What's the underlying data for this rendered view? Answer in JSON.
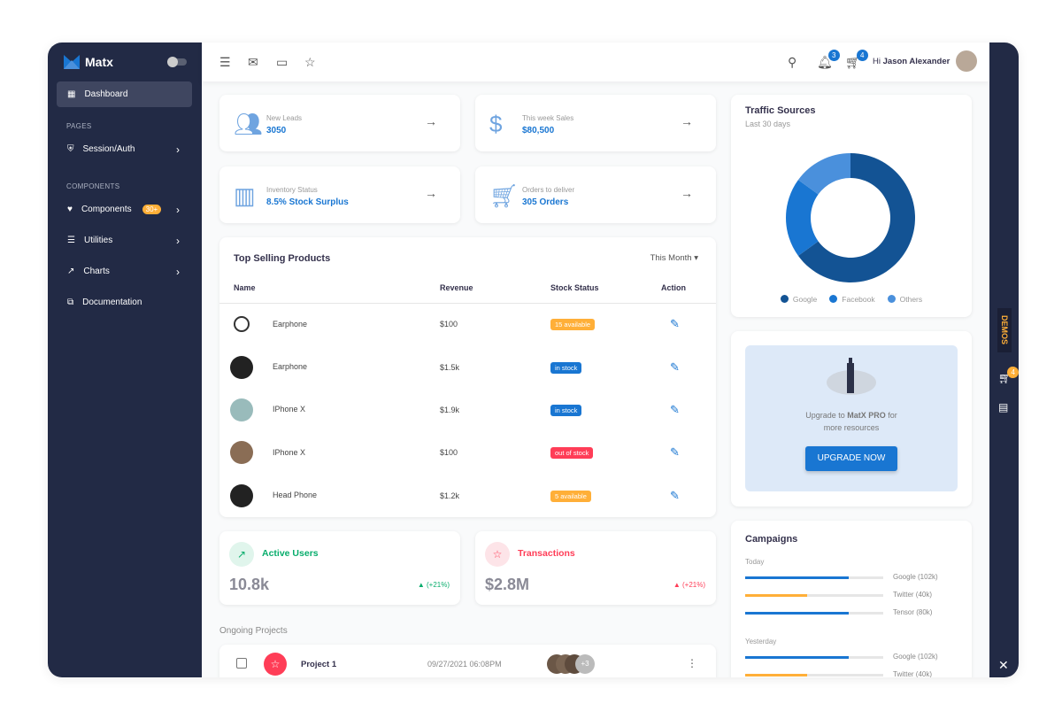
{
  "brand": {
    "name": "Matx"
  },
  "sidebar": {
    "items": [
      {
        "label": "Dashboard"
      },
      {
        "label": "Session/Auth"
      },
      {
        "label": "Components",
        "badge": "30+"
      },
      {
        "label": "Utilities"
      },
      {
        "label": "Charts"
      },
      {
        "label": "Documentation"
      }
    ],
    "sections": [
      "PAGES",
      "COMPONENTS"
    ]
  },
  "topbar": {
    "greeting": "Hi",
    "user": "Jason Alexander",
    "notifications": "3",
    "cart": "4"
  },
  "stats": [
    {
      "label": "New Leads",
      "value": "3050",
      "icon": "group-icon"
    },
    {
      "label": "This week Sales",
      "value": "$80,500",
      "icon": "dollar-icon"
    },
    {
      "label": "Inventory Status",
      "value": "8.5% Stock Surplus",
      "icon": "store-icon"
    },
    {
      "label": "Orders to deliver",
      "value": "305 Orders",
      "icon": "cart-icon"
    }
  ],
  "products": {
    "title": "Top Selling Products",
    "filter": "This Month",
    "columns": [
      "Name",
      "Revenue",
      "Stock Status",
      "Action"
    ],
    "rows": [
      {
        "name": "Earphone",
        "revenue": "$100",
        "status": "15 available",
        "color": "#ffaf38"
      },
      {
        "name": "Earphone",
        "revenue": "$1.5k",
        "status": "in stock",
        "color": "#1976d2"
      },
      {
        "name": "IPhone X",
        "revenue": "$1.9k",
        "status": "in stock",
        "color": "#1976d2"
      },
      {
        "name": "IPhone X",
        "revenue": "$100",
        "status": "out of stock",
        "color": "#ff3d57"
      },
      {
        "name": "Head Phone",
        "revenue": "$1.2k",
        "status": "5 available",
        "color": "#ffaf38"
      }
    ]
  },
  "active_users": {
    "label": "Active Users",
    "value": "10.8k",
    "change": "(+21%)"
  },
  "transactions": {
    "label": "Transactions",
    "value": "$2.8M",
    "change": "(+21%)"
  },
  "projects": {
    "title": "Ongoing Projects",
    "items": [
      {
        "name": "Project 1",
        "date": "09/27/2021 06:08PM",
        "more": "+3"
      }
    ]
  },
  "traffic": {
    "title": "Traffic Sources",
    "subtitle": "Last 30 days"
  },
  "chart_data": {
    "type": "pie",
    "donut": true,
    "categories": [
      "Google",
      "Facebook",
      "Others"
    ],
    "values": [
      65,
      20,
      15
    ],
    "colors": [
      "#135394",
      "#1976d2",
      "#4a90dc"
    ],
    "legend": "bottom"
  },
  "upgrade": {
    "text_pre": "Upgrade to",
    "text_bold": "MatX PRO",
    "text_post": "for",
    "text_line2": "more resources",
    "button": "UPGRADE NOW"
  },
  "campaigns": {
    "title": "Campaigns",
    "groups": [
      {
        "label": "Today",
        "items": [
          {
            "name": "Google (102k)",
            "value": 75,
            "color": "#1976d2"
          },
          {
            "name": "Twitter (40k)",
            "value": 45,
            "color": "#ffaf38"
          },
          {
            "name": "Tensor (80k)",
            "value": 75,
            "color": "#1976d2"
          }
        ]
      },
      {
        "label": "Yesterday",
        "items": [
          {
            "name": "Google (102k)",
            "value": 75,
            "color": "#1976d2"
          },
          {
            "name": "Twitter (40k)",
            "value": 45,
            "color": "#ffaf38"
          }
        ]
      }
    ]
  },
  "demos": "DEMOS",
  "demo_cart": "4"
}
